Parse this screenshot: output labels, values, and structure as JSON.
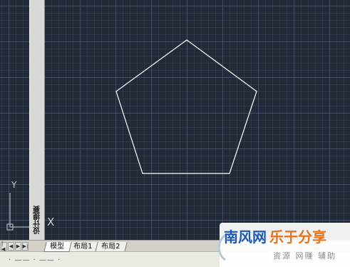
{
  "canvas": {
    "background_color": "#222a37",
    "grid_color": "#50607a",
    "shape": "pentagon",
    "shape_color": "#ffffff"
  },
  "ucs": {
    "y_label": "Y",
    "x_label": "X"
  },
  "palette": {
    "label": "设计提要"
  },
  "tabbar": {
    "nav_buttons": [
      "|◀",
      "◀",
      "▶",
      "▶|"
    ],
    "tabs": [
      {
        "label": "模型",
        "active": true
      },
      {
        "label": "布局1",
        "active": false
      },
      {
        "label": "布局2",
        "active": false
      }
    ]
  },
  "statusbar": {
    "text": "· —— · —— ·"
  },
  "watermark": {
    "left_text": "南风网",
    "right_text": "乐于分享",
    "sub_text": "资源 网赚 辅助",
    "left_color": "#1e5ab4",
    "right_color": "#e8731a"
  }
}
